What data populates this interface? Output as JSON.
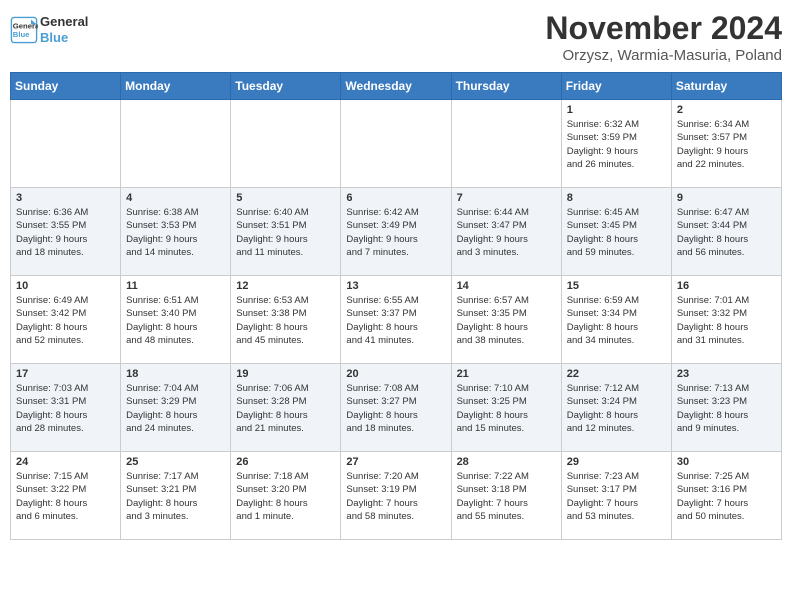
{
  "logo": {
    "line1": "General",
    "line2": "Blue"
  },
  "title": "November 2024",
  "location": "Orzysz, Warmia-Masuria, Poland",
  "weekdays": [
    "Sunday",
    "Monday",
    "Tuesday",
    "Wednesday",
    "Thursday",
    "Friday",
    "Saturday"
  ],
  "weeks": [
    [
      {
        "day": "",
        "info": ""
      },
      {
        "day": "",
        "info": ""
      },
      {
        "day": "",
        "info": ""
      },
      {
        "day": "",
        "info": ""
      },
      {
        "day": "",
        "info": ""
      },
      {
        "day": "1",
        "info": "Sunrise: 6:32 AM\nSunset: 3:59 PM\nDaylight: 9 hours\nand 26 minutes."
      },
      {
        "day": "2",
        "info": "Sunrise: 6:34 AM\nSunset: 3:57 PM\nDaylight: 9 hours\nand 22 minutes."
      }
    ],
    [
      {
        "day": "3",
        "info": "Sunrise: 6:36 AM\nSunset: 3:55 PM\nDaylight: 9 hours\nand 18 minutes."
      },
      {
        "day": "4",
        "info": "Sunrise: 6:38 AM\nSunset: 3:53 PM\nDaylight: 9 hours\nand 14 minutes."
      },
      {
        "day": "5",
        "info": "Sunrise: 6:40 AM\nSunset: 3:51 PM\nDaylight: 9 hours\nand 11 minutes."
      },
      {
        "day": "6",
        "info": "Sunrise: 6:42 AM\nSunset: 3:49 PM\nDaylight: 9 hours\nand 7 minutes."
      },
      {
        "day": "7",
        "info": "Sunrise: 6:44 AM\nSunset: 3:47 PM\nDaylight: 9 hours\nand 3 minutes."
      },
      {
        "day": "8",
        "info": "Sunrise: 6:45 AM\nSunset: 3:45 PM\nDaylight: 8 hours\nand 59 minutes."
      },
      {
        "day": "9",
        "info": "Sunrise: 6:47 AM\nSunset: 3:44 PM\nDaylight: 8 hours\nand 56 minutes."
      }
    ],
    [
      {
        "day": "10",
        "info": "Sunrise: 6:49 AM\nSunset: 3:42 PM\nDaylight: 8 hours\nand 52 minutes."
      },
      {
        "day": "11",
        "info": "Sunrise: 6:51 AM\nSunset: 3:40 PM\nDaylight: 8 hours\nand 48 minutes."
      },
      {
        "day": "12",
        "info": "Sunrise: 6:53 AM\nSunset: 3:38 PM\nDaylight: 8 hours\nand 45 minutes."
      },
      {
        "day": "13",
        "info": "Sunrise: 6:55 AM\nSunset: 3:37 PM\nDaylight: 8 hours\nand 41 minutes."
      },
      {
        "day": "14",
        "info": "Sunrise: 6:57 AM\nSunset: 3:35 PM\nDaylight: 8 hours\nand 38 minutes."
      },
      {
        "day": "15",
        "info": "Sunrise: 6:59 AM\nSunset: 3:34 PM\nDaylight: 8 hours\nand 34 minutes."
      },
      {
        "day": "16",
        "info": "Sunrise: 7:01 AM\nSunset: 3:32 PM\nDaylight: 8 hours\nand 31 minutes."
      }
    ],
    [
      {
        "day": "17",
        "info": "Sunrise: 7:03 AM\nSunset: 3:31 PM\nDaylight: 8 hours\nand 28 minutes."
      },
      {
        "day": "18",
        "info": "Sunrise: 7:04 AM\nSunset: 3:29 PM\nDaylight: 8 hours\nand 24 minutes."
      },
      {
        "day": "19",
        "info": "Sunrise: 7:06 AM\nSunset: 3:28 PM\nDaylight: 8 hours\nand 21 minutes."
      },
      {
        "day": "20",
        "info": "Sunrise: 7:08 AM\nSunset: 3:27 PM\nDaylight: 8 hours\nand 18 minutes."
      },
      {
        "day": "21",
        "info": "Sunrise: 7:10 AM\nSunset: 3:25 PM\nDaylight: 8 hours\nand 15 minutes."
      },
      {
        "day": "22",
        "info": "Sunrise: 7:12 AM\nSunset: 3:24 PM\nDaylight: 8 hours\nand 12 minutes."
      },
      {
        "day": "23",
        "info": "Sunrise: 7:13 AM\nSunset: 3:23 PM\nDaylight: 8 hours\nand 9 minutes."
      }
    ],
    [
      {
        "day": "24",
        "info": "Sunrise: 7:15 AM\nSunset: 3:22 PM\nDaylight: 8 hours\nand 6 minutes."
      },
      {
        "day": "25",
        "info": "Sunrise: 7:17 AM\nSunset: 3:21 PM\nDaylight: 8 hours\nand 3 minutes."
      },
      {
        "day": "26",
        "info": "Sunrise: 7:18 AM\nSunset: 3:20 PM\nDaylight: 8 hours\nand 1 minute."
      },
      {
        "day": "27",
        "info": "Sunrise: 7:20 AM\nSunset: 3:19 PM\nDaylight: 7 hours\nand 58 minutes."
      },
      {
        "day": "28",
        "info": "Sunrise: 7:22 AM\nSunset: 3:18 PM\nDaylight: 7 hours\nand 55 minutes."
      },
      {
        "day": "29",
        "info": "Sunrise: 7:23 AM\nSunset: 3:17 PM\nDaylight: 7 hours\nand 53 minutes."
      },
      {
        "day": "30",
        "info": "Sunrise: 7:25 AM\nSunset: 3:16 PM\nDaylight: 7 hours\nand 50 minutes."
      }
    ]
  ]
}
